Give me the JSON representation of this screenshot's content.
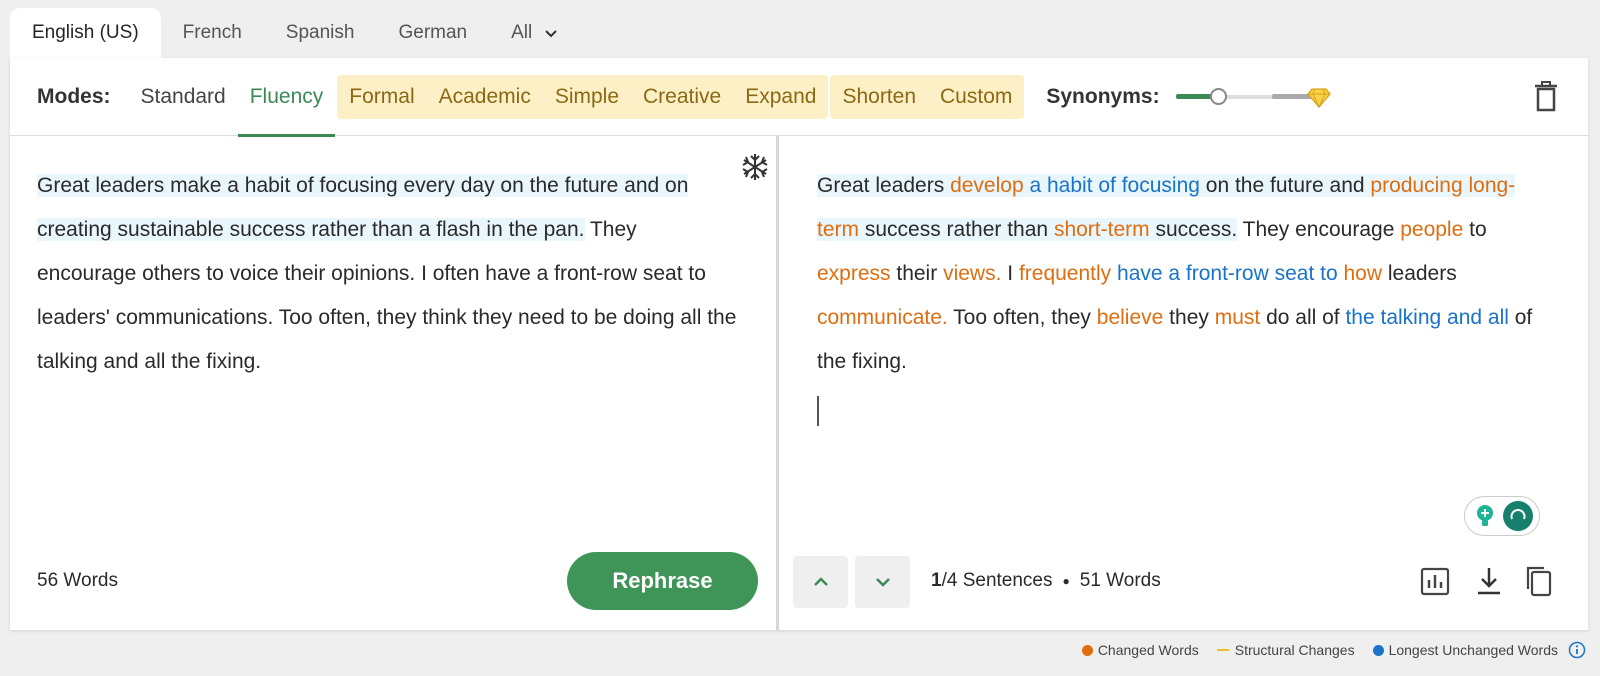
{
  "languages": {
    "tabs": [
      "English (US)",
      "French",
      "Spanish",
      "German",
      "All"
    ],
    "active": "English (US)"
  },
  "modes": {
    "label": "Modes:",
    "items": [
      "Standard",
      "Fluency",
      "Formal",
      "Academic",
      "Simple",
      "Creative",
      "Expand",
      "Shorten",
      "Custom"
    ],
    "active": "Fluency"
  },
  "synonyms": {
    "label": "Synonyms:",
    "level": 0.3
  },
  "input": {
    "sentences": [
      "Great leaders make a habit of focusing every day on the future and on creating sustainable success rather than a flash in the pan.",
      " They encourage others to voice their opinions. I often have a front-row seat to leaders' communications. Too often, they think they need to be doing all the talking and all the fixing."
    ],
    "word_count": "56 Words",
    "rephrase_label": "Rephrase"
  },
  "output": {
    "segments": [
      {
        "t": "Great leaders ",
        "c": "h"
      },
      {
        "t": "develop",
        "c": "hchg"
      },
      {
        "t": " ",
        "c": "h"
      },
      {
        "t": "a habit of focusing",
        "c": "hunch"
      },
      {
        "t": " on the future and ",
        "c": "h"
      },
      {
        "t": "producing long-term",
        "c": "hchg"
      },
      {
        "t": " success rather than ",
        "c": "h"
      },
      {
        "t": "short-term",
        "c": "hchg"
      },
      {
        "t": " success.",
        "c": "h"
      },
      {
        "t": " They encourage ",
        "c": ""
      },
      {
        "t": "people",
        "c": "chg"
      },
      {
        "t": " to ",
        "c": ""
      },
      {
        "t": "express",
        "c": "chg"
      },
      {
        "t": " their ",
        "c": ""
      },
      {
        "t": "views.",
        "c": "chg"
      },
      {
        "t": " I ",
        "c": ""
      },
      {
        "t": "frequently",
        "c": "chg"
      },
      {
        "t": " ",
        "c": ""
      },
      {
        "t": "have a front-row seat to",
        "c": "unch"
      },
      {
        "t": " ",
        "c": ""
      },
      {
        "t": "how",
        "c": "chg"
      },
      {
        "t": " leaders ",
        "c": ""
      },
      {
        "t": "communicate.",
        "c": "chg"
      },
      {
        "t": " Too often, they ",
        "c": ""
      },
      {
        "t": "believe",
        "c": "chg"
      },
      {
        "t": " they ",
        "c": ""
      },
      {
        "t": "must",
        "c": "chg"
      },
      {
        "t": " do all of ",
        "c": ""
      },
      {
        "t": "the talking and all",
        "c": "unch"
      },
      {
        "t": " of the fixing.",
        "c": ""
      }
    ],
    "sentence_current": "1",
    "sentence_total": "/4 Sentences",
    "word_count": "51 Words"
  },
  "legend": {
    "changed": "Changed Words",
    "structural": "Structural Changes",
    "unchanged": "Longest Unchanged Words"
  },
  "colors": {
    "accent": "#3b8a56",
    "changed": "#e06d10",
    "unchanged": "#1a73c9",
    "structural": "#e8c42b",
    "premium_bg": "#fdf0c7"
  }
}
